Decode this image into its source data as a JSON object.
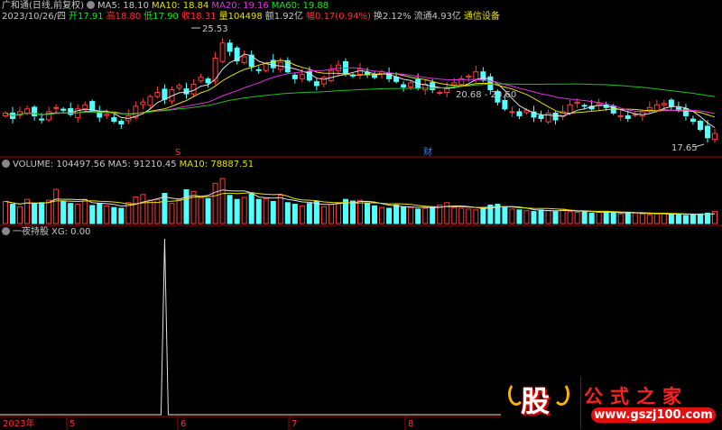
{
  "header": {
    "stock": "广和通(日线,前复权)",
    "ma5": "MA5: 18.10",
    "ma10": "MA10: 18.84",
    "ma20": "MA20: 19.16",
    "ma60": "MA60: 19.88",
    "date": "2023/10/26/四",
    "open": "开17.91",
    "high": "高18.80",
    "low": "低17.90",
    "close": "收18.31",
    "vol": "量104498",
    "amount": "额1.92亿",
    "change": "幅0.17(0.94%)",
    "turnover": "换2.12%",
    "float": "流通4.93亿",
    "sector": "通信设备"
  },
  "annotations": {
    "high_label": "25.53",
    "low_label": "17.65",
    "range_label": "20.68 - 20.60",
    "marker_s": "S",
    "marker_cai": "财"
  },
  "volume": {
    "title": "VOLUME: 104497.56",
    "ma5": "MA5: 91210.45",
    "ma10": "MA10: 78887.51"
  },
  "indicator": {
    "title": "一夜持股",
    "xg": "XG: 0.00"
  },
  "xaxis": {
    "labels": [
      "2023年",
      "5",
      "6",
      "7",
      "8"
    ]
  },
  "logo": {
    "text": "公式之家",
    "badge": "股",
    "url": "www.gszj100.com"
  },
  "colors": {
    "up": "#ff3c3c",
    "down": "#54ffff",
    "ma5": "#e0e0e0",
    "ma10": "#e8e000",
    "ma20": "#e030e0",
    "ma60": "#20c020"
  },
  "chart_data": {
    "type": "candlestick",
    "closes": [
      19.8,
      19.4,
      19.9,
      20.1,
      19.6,
      19.3,
      19.9,
      20.2,
      20.0,
      19.7,
      20.1,
      20.4,
      20.0,
      19.5,
      19.7,
      19.2,
      19.0,
      19.6,
      20.3,
      20.6,
      21.0,
      21.3,
      20.8,
      21.5,
      21.8,
      21.2,
      21.9,
      22.4,
      22.0,
      23.8,
      24.9,
      24.3,
      23.6,
      23.9,
      23.2,
      22.9,
      23.4,
      23.1,
      23.5,
      22.8,
      22.3,
      22.6,
      22.2,
      21.8,
      22.4,
      22.9,
      23.3,
      22.7,
      22.5,
      23.0,
      22.6,
      22.4,
      22.8,
      22.3,
      22.1,
      21.7,
      22.0,
      21.6,
      21.9,
      21.5,
      21.3,
      21.6,
      22.0,
      22.3,
      22.5,
      22.8,
      22.2,
      21.5,
      20.6,
      20.1,
      19.9,
      19.6,
      20.0,
      19.5,
      19.4,
      19.8,
      19.3,
      19.9,
      20.4,
      20.6,
      20.3,
      20.1,
      20.5,
      20.2,
      19.8,
      19.6,
      19.4,
      19.7,
      19.9,
      20.2,
      20.4,
      20.5,
      20.3,
      20.0,
      19.6,
      19.2,
      18.6,
      18.0,
      18.31
    ],
    "volumes": [
      55,
      48,
      42,
      60,
      50,
      52,
      58,
      85,
      56,
      50,
      48,
      60,
      45,
      50,
      44,
      40,
      38,
      52,
      66,
      72,
      58,
      60,
      75,
      50,
      60,
      84,
      80,
      64,
      62,
      100,
      112,
      70,
      60,
      65,
      74,
      60,
      62,
      55,
      70,
      52,
      48,
      44,
      50,
      55,
      42,
      48,
      52,
      60,
      56,
      58,
      50,
      44,
      40,
      38,
      46,
      42,
      40,
      36,
      38,
      42,
      46,
      52,
      40,
      38,
      36,
      34,
      40,
      46,
      48,
      42,
      36,
      34,
      32,
      30,
      34,
      32,
      30,
      36,
      30,
      28,
      30,
      26,
      28,
      30,
      26,
      24,
      28,
      26,
      24,
      22,
      24,
      26,
      22,
      24,
      20,
      22,
      24,
      26,
      30
    ],
    "price_range": [
      17.0,
      26.2
    ],
    "indicator_spike_index": 22
  }
}
